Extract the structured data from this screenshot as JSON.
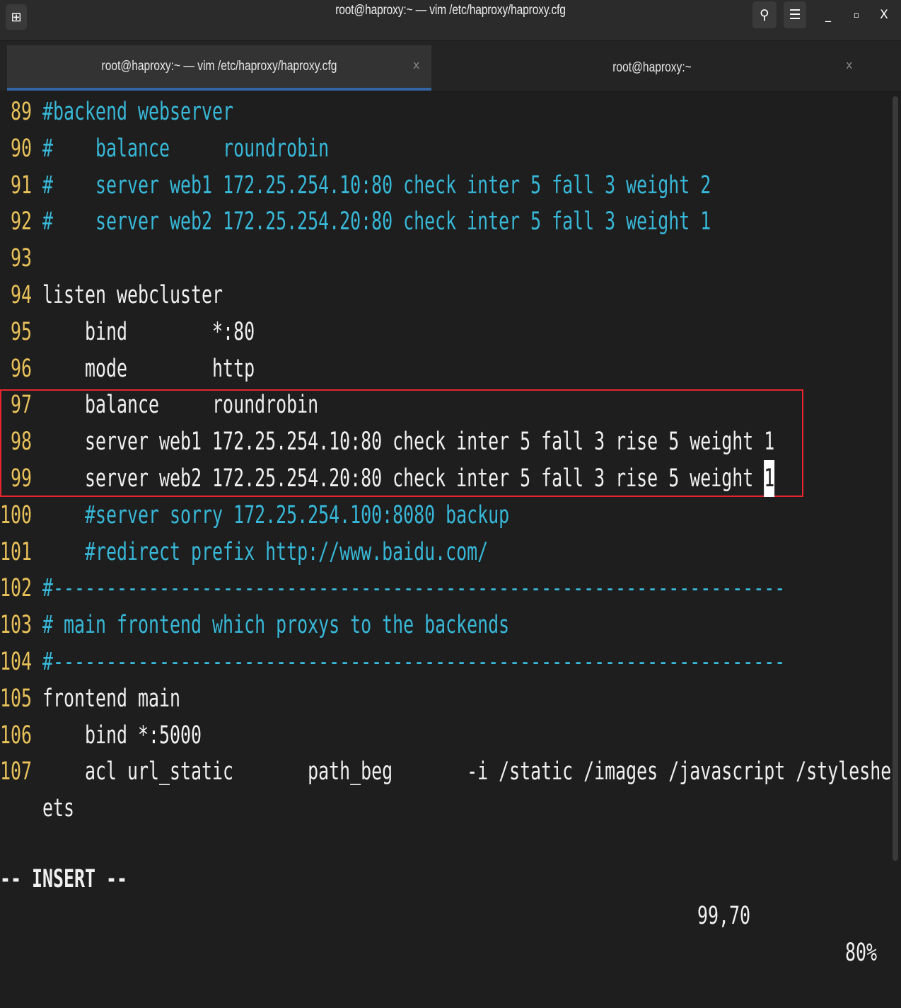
{
  "window": {
    "title": "root@haproxy:~ — vim /etc/haproxy/haproxy.cfg",
    "new_tab_icon": "⊞",
    "search_icon": "⚲",
    "menu_icon": "☰",
    "minimize_icon": "_",
    "maximize_icon": "▫",
    "close_icon": "X"
  },
  "tabs": [
    {
      "label": "root@haproxy:~ — vim /etc/haproxy/haproxy.cfg",
      "close": "x",
      "active": true
    },
    {
      "label": "root@haproxy:~",
      "close": "x",
      "active": false
    }
  ],
  "tabs_dropdown_icon": "▼",
  "editor": {
    "lines": [
      {
        "num": "89",
        "text": "#backend webserver",
        "style": "comment"
      },
      {
        "num": "90",
        "text": "#    balance     roundrobin",
        "style": "comment"
      },
      {
        "num": "91",
        "text": "#    server web1 172.25.254.10:80 check inter 5 fall 3 weight 2",
        "style": "comment"
      },
      {
        "num": "92",
        "text": "#    server web2 172.25.254.20:80 check inter 5 fall 3 weight 1",
        "style": "comment"
      },
      {
        "num": "93",
        "text": "",
        "style": "plain"
      },
      {
        "num": "94",
        "text": "listen webcluster",
        "style": "plain"
      },
      {
        "num": "95",
        "text": "    bind        *:80",
        "style": "plain"
      },
      {
        "num": "96",
        "text": "    mode        http",
        "style": "plain"
      },
      {
        "num": "97",
        "text": "    balance     roundrobin",
        "style": "plain"
      },
      {
        "num": "98",
        "text": "    server web1 172.25.254.10:80 check inter 5 fall 3 rise 5 weight 1",
        "style": "plain"
      },
      {
        "num": "99",
        "text": "    server web2 172.25.254.20:80 check inter 5 fall 3 rise 5 weight 1",
        "style": "plain",
        "cursor": true
      },
      {
        "num": "100",
        "text": "    #server sorry 172.25.254.100:8080 backup",
        "style": "comment"
      },
      {
        "num": "101",
        "text": "    #redirect prefix http://www.baidu.com/",
        "style": "comment"
      },
      {
        "num": "102",
        "text": "#---------------------------------------------------------------------",
        "style": "comment"
      },
      {
        "num": "103",
        "text": "# main frontend which proxys to the backends",
        "style": "comment"
      },
      {
        "num": "104",
        "text": "#---------------------------------------------------------------------",
        "style": "comment"
      },
      {
        "num": "105",
        "text": "frontend main",
        "style": "plain"
      },
      {
        "num": "106",
        "text": "    bind *:5000",
        "style": "plain"
      },
      {
        "num": "107",
        "text": "    acl url_static       path_beg       -i /static /images /javascript /styleshe",
        "style": "plain"
      },
      {
        "num": "",
        "text": "ets",
        "style": "plain"
      }
    ],
    "cursor_char": "1"
  },
  "status": {
    "mode": "-- INSERT --",
    "position": "99,70",
    "scroll": "80%"
  }
}
